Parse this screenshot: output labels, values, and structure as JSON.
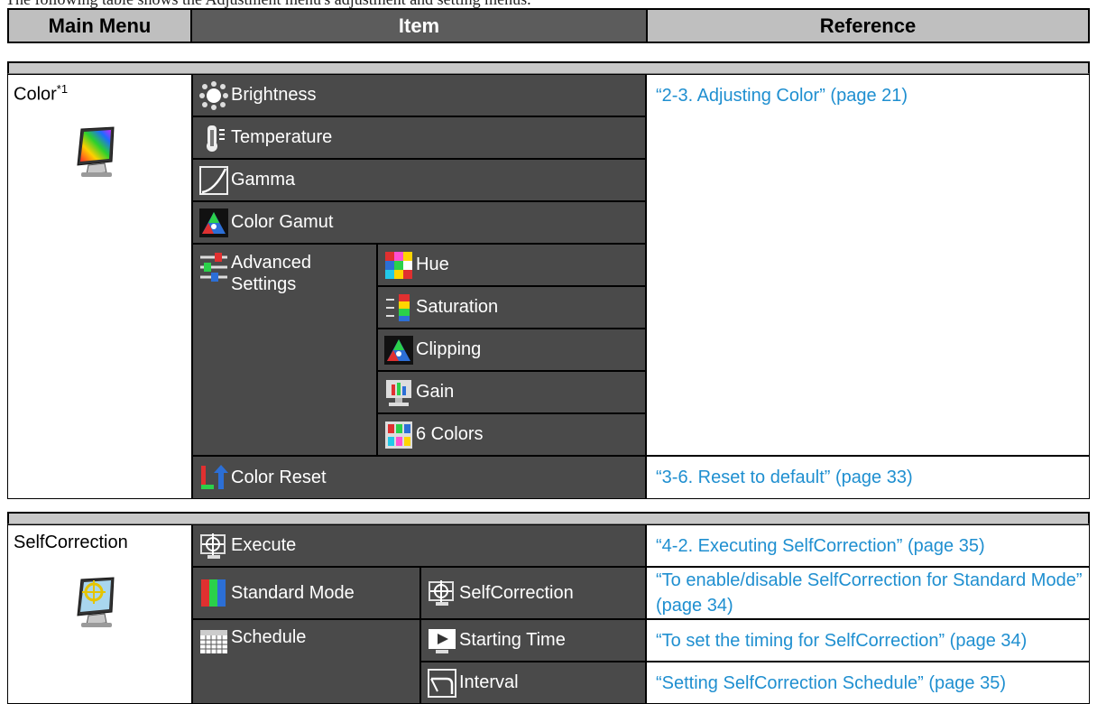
{
  "intro_text": "The following table shows the Adjustment menu's adjustment and setting menus.",
  "header": {
    "main_menu": "Main Menu",
    "item": "Item",
    "reference": "Reference"
  },
  "color_section": {
    "label": "Color",
    "footnote": "*1",
    "items": {
      "brightness": "Brightness",
      "temperature": "Temperature",
      "gamma": "Gamma",
      "color_gamut": "Color Gamut",
      "advanced_settings": "Advanced Settings",
      "hue": "Hue",
      "saturation": "Saturation",
      "clipping": "Clipping",
      "gain": "Gain",
      "six_colors": "6 Colors",
      "color_reset": "Color Reset"
    },
    "refs": {
      "adjusting_color": "“2-3. Adjusting Color” (page 21)",
      "reset_default": "“3-6. Reset to default” (page 33)"
    }
  },
  "selfcorrection_section": {
    "label": "SelfCorrection",
    "items": {
      "execute": "Execute",
      "standard_mode": "Standard Mode",
      "selfcorrection": "SelfCorrection",
      "schedule": "Schedule",
      "starting_time": "Starting Time",
      "interval": "Interval"
    },
    "refs": {
      "executing": "“4-2. Executing SelfCorrection” (page 35)",
      "enable_disable": "“To enable/disable SelfCorrection for Standard Mode” (page 34)",
      "timing": "“To set the timing for SelfCorrection” (page 34)",
      "schedule": "“Setting SelfCorrection Schedule” (page 35)"
    }
  }
}
